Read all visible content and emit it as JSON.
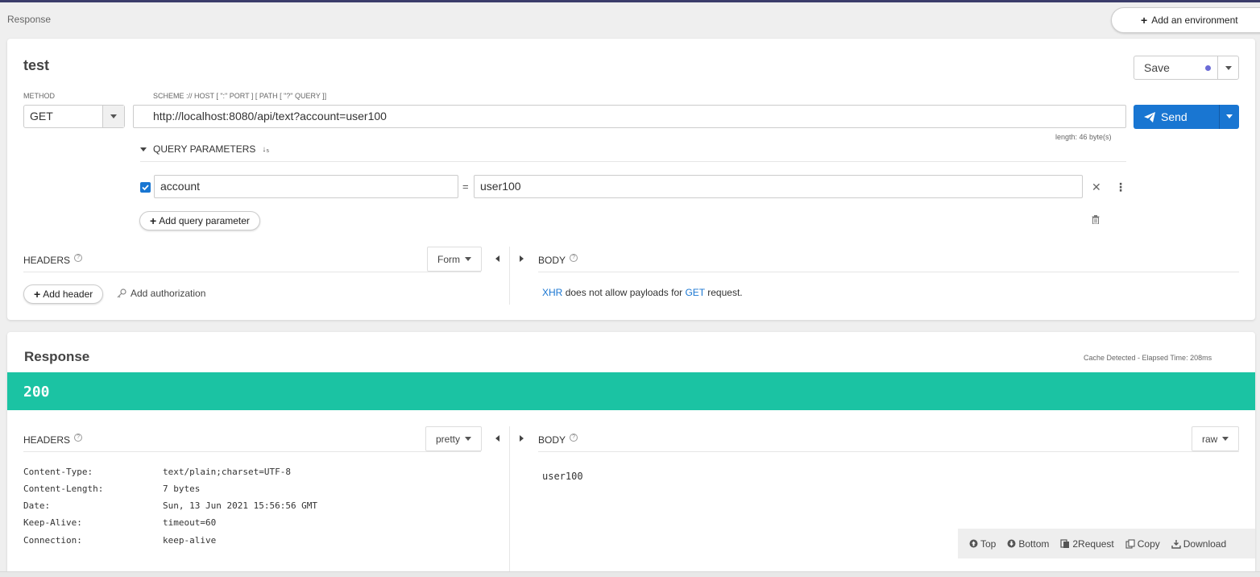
{
  "breadcrumb": "Response",
  "environment_button": "Add an environment",
  "request": {
    "title": "test",
    "save_label": "Save",
    "method_label": "METHOD",
    "method_value": "GET",
    "url_hint": "SCHEME :// HOST [ \":\" PORT ] [ PATH [ \"?\" QUERY ]]",
    "url": "http://localhost:8080/api/text?account=user100",
    "url_length": "length: 46 byte(s)",
    "send_label": "Send",
    "query_params_label": "QUERY PARAMETERS",
    "query_params": [
      {
        "enabled": true,
        "name": "account",
        "value": "user100"
      }
    ],
    "add_query_param": "Add query parameter",
    "headers_label": "HEADERS",
    "headers_mode": "Form",
    "add_header": "Add header",
    "add_authorization": "Add authorization",
    "body_label": "BODY",
    "body_note": {
      "xhr": "XHR",
      "mid": "does not allow payloads for",
      "method": "GET",
      "end": "request."
    }
  },
  "response": {
    "title": "Response",
    "elapsed": "Cache Detected - Elapsed Time: 208ms",
    "status": "200",
    "headers_label": "HEADERS",
    "headers_mode": "pretty",
    "headers": [
      {
        "key": "Content-Type:",
        "value": "text/plain;charset=UTF-8"
      },
      {
        "key": "Content-Length:",
        "value": "7 bytes"
      },
      {
        "key": "Date:",
        "value": "Sun, 13 Jun 2021 15:56:56 GMT"
      },
      {
        "key": "Keep-Alive:",
        "value": "timeout=60"
      },
      {
        "key": "Connection:",
        "value": "keep-alive"
      }
    ],
    "body_label": "BODY",
    "body_mode": "raw",
    "body": "user100",
    "footer": {
      "top": "Top",
      "bottom": "Bottom",
      "to_request": "2Request",
      "copy": "Copy",
      "download": "Download"
    }
  },
  "colors": {
    "accent": "#1976d2",
    "status_ok": "#1bc3a3"
  }
}
